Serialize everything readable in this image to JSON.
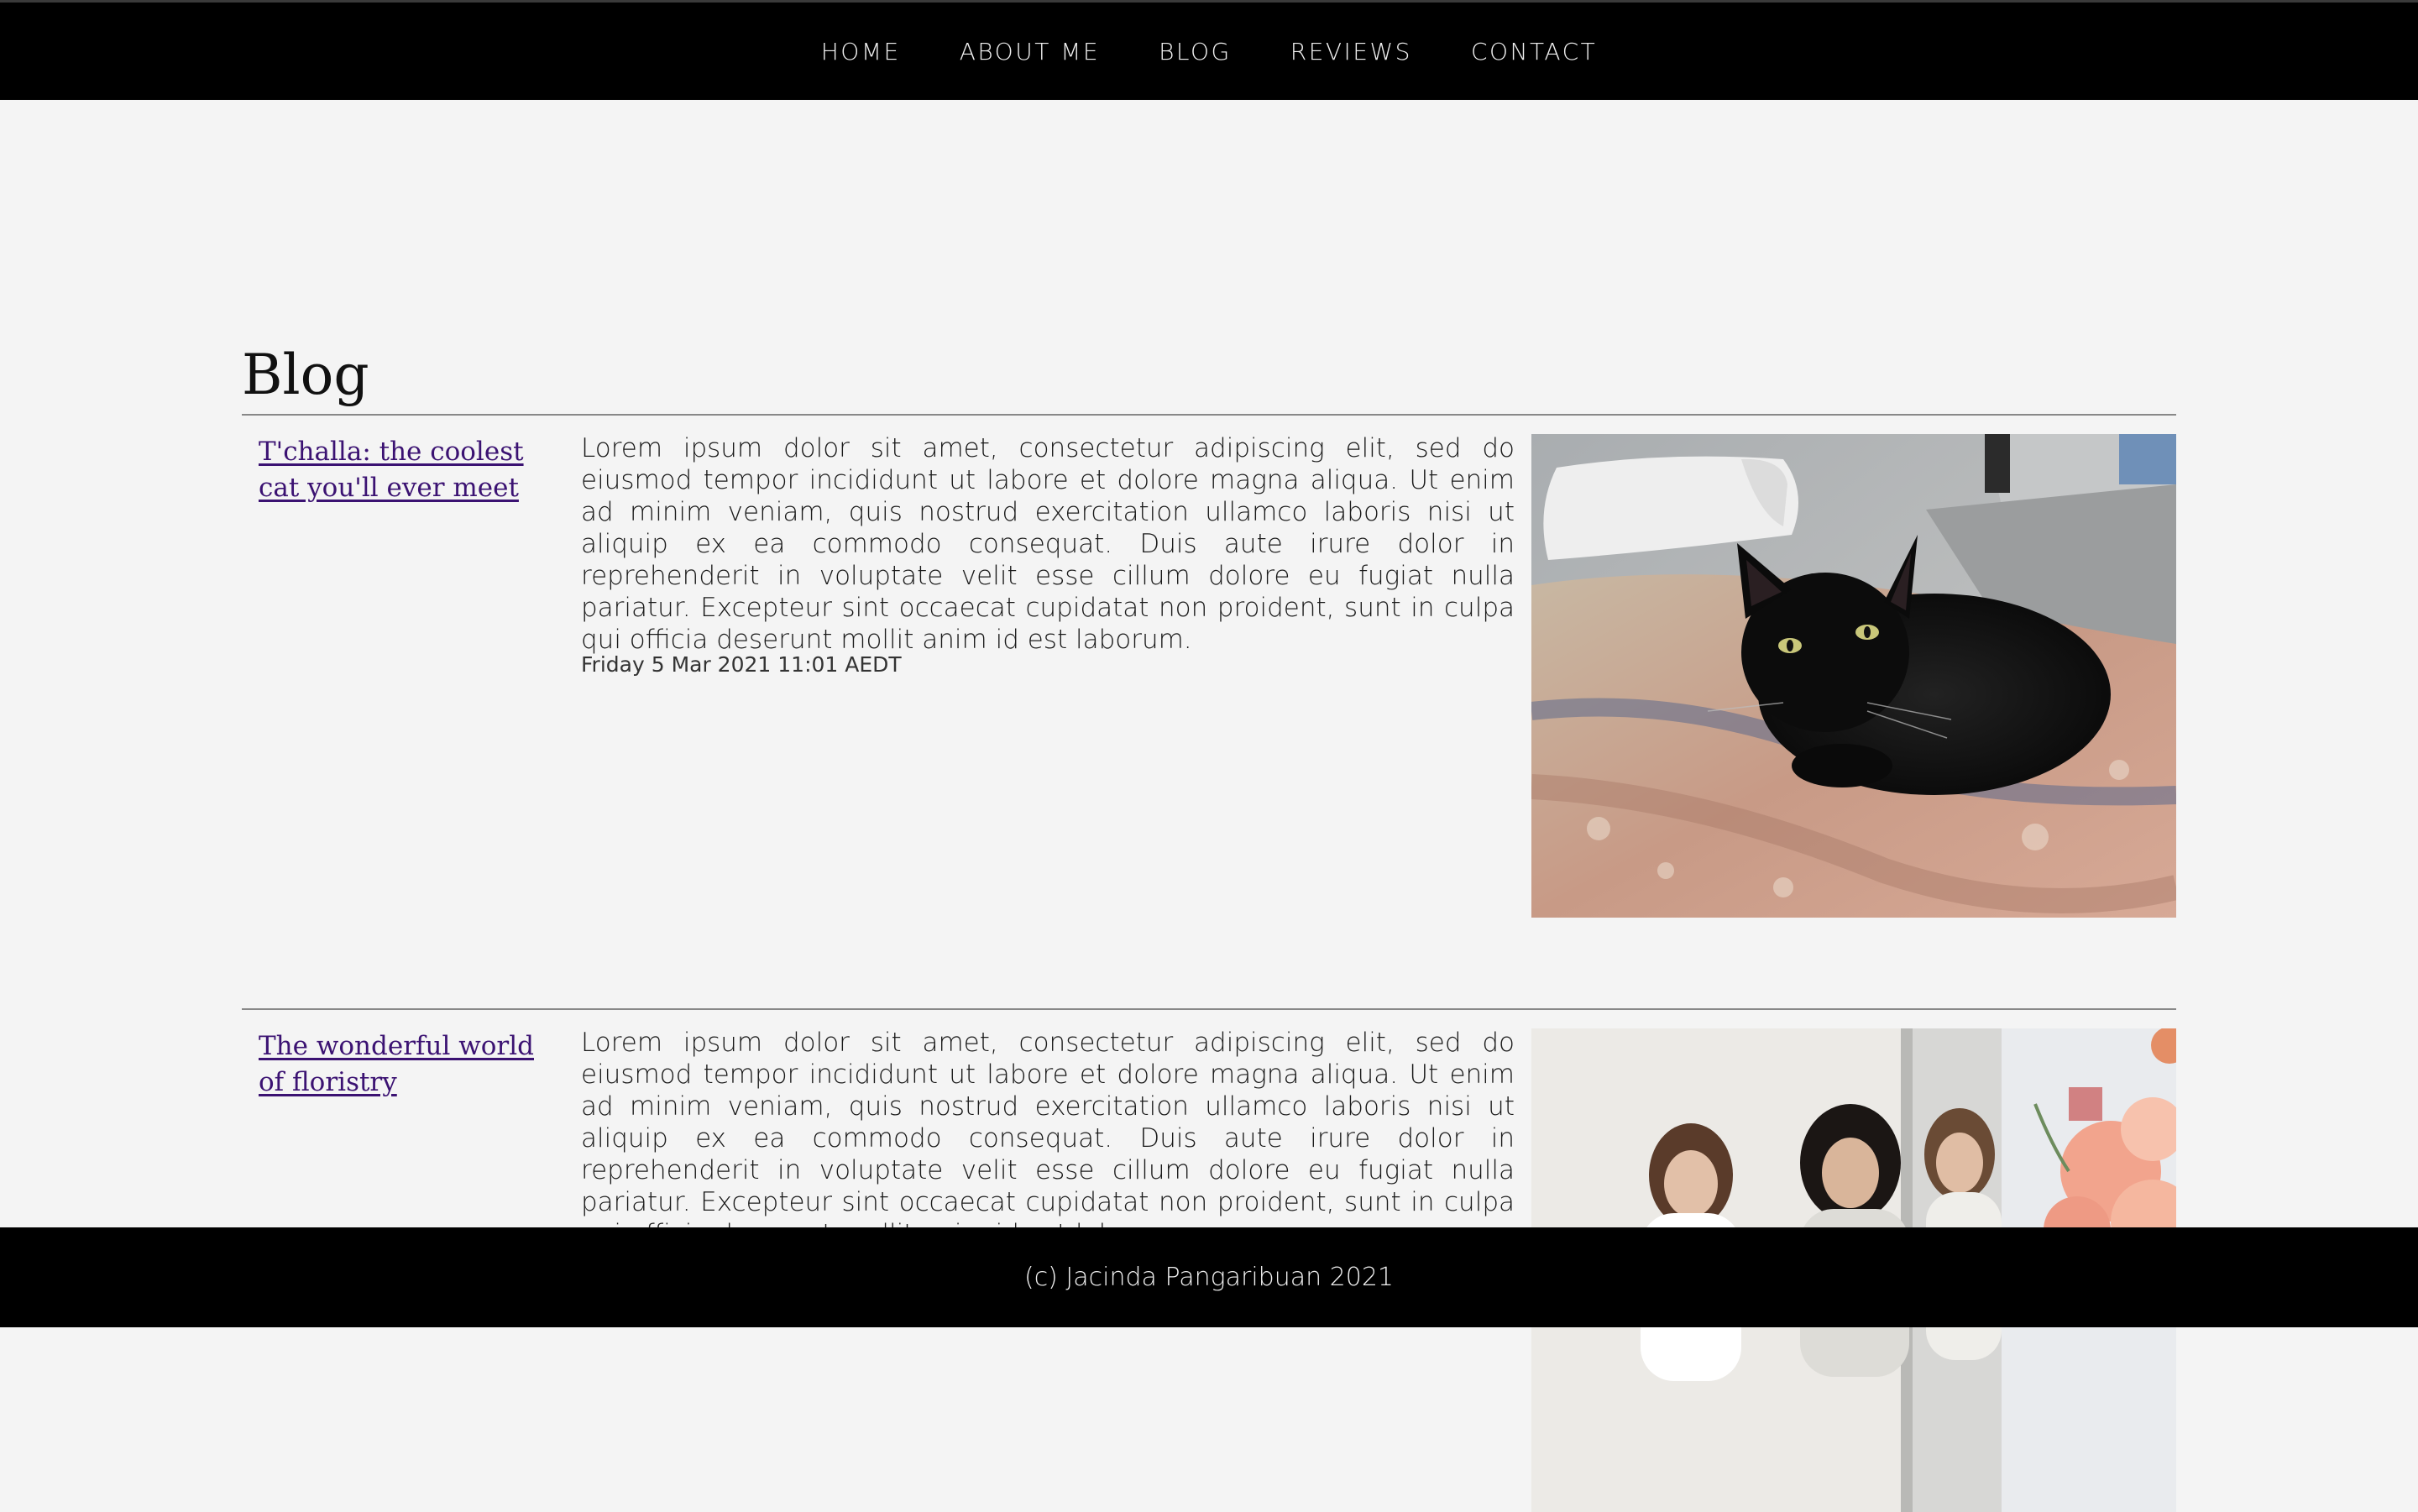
{
  "nav": {
    "items": [
      {
        "label": "HOME"
      },
      {
        "label": "ABOUT ME"
      },
      {
        "label": "BLOG"
      },
      {
        "label": "REVIEWS"
      },
      {
        "label": "CONTACT"
      }
    ]
  },
  "page": {
    "title": "Blog"
  },
  "posts": [
    {
      "title": "T'challa: the coolest cat you'll ever meet",
      "body": "Lorem ipsum dolor sit amet, consectetur adipiscing elit, sed do eiusmod tempor incididunt ut labore et dolore magna aliqua. Ut enim ad minim veniam, quis nostrud exercitation ullamco laboris nisi ut aliquip ex ea commodo consequat. Duis aute irure dolor in reprehenderit in voluptate velit esse cillum dolore eu fugiat nulla pariatur. Excepteur sint occaecat cupidatat non proident, sunt in culpa qui officia deserunt mollit anim id est laborum.",
      "date": "Friday 5 Mar 2021 11:01 AEDT",
      "image": "black-cat-on-bed-photo"
    },
    {
      "title": "The wonderful world of floristry",
      "body": "Lorem ipsum dolor sit amet, consectetur adipiscing elit, sed do eiusmod tempor incididunt ut labore et dolore magna aliqua. Ut enim ad minim veniam, quis nostrud exercitation ullamco laboris nisi ut aliquip ex ea commodo consequat. Duis aute irure dolor in reprehenderit in voluptate velit esse cillum dolore eu fugiat nulla pariatur. Excepteur sint occaecat cupidatat non proident, sunt in culpa qui officia deserunt mollit anim id est laborum.",
      "image": "floristry-workshop-photo"
    }
  ],
  "footer": {
    "text": "(c) Jacinda Pangaribuan 2021"
  }
}
